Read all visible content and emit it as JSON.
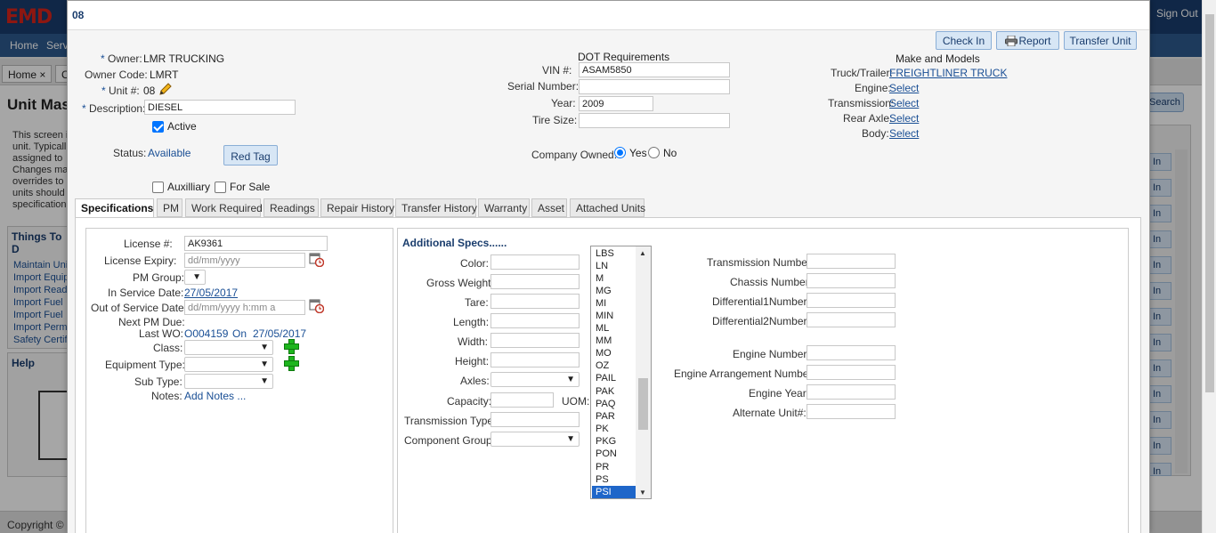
{
  "background": {
    "logo": "EMD",
    "sign_out": "Sign Out",
    "nav": [
      "Home",
      "Servi"
    ],
    "tabs": [
      "Home ×",
      "C"
    ],
    "page_title": "Unit Mas",
    "description": "This screen i unit. Typicall assigned to Changes ma overrides to units should specification",
    "things_to_do": {
      "title": "Things To D",
      "links": [
        "Maintain Uni",
        "Import Equip",
        "Import Read",
        "Import Fuel",
        "Import Fuel",
        "Import Perm",
        "Safety Certif"
      ]
    },
    "help_title": "Help",
    "search_label": "Search",
    "in_buttons": [
      "In",
      "In",
      "In",
      "In",
      "In",
      "In",
      "In",
      "In",
      "In",
      "In",
      "In",
      "In",
      "In"
    ],
    "footer": "Copyright © 2"
  },
  "modal": {
    "title": "08",
    "buttons": {
      "check_in": "Check In",
      "report": "Report",
      "transfer_unit": "Transfer Unit"
    },
    "owner": {
      "label": "Owner:",
      "value": "LMR TRUCKING"
    },
    "owner_code": {
      "label": "Owner Code:",
      "value": "LMRT"
    },
    "unit_number": {
      "label": "Unit #:",
      "value": "08"
    },
    "description": {
      "label": "Description:",
      "value": "DIESEL"
    },
    "active": {
      "label": "Active",
      "checked": true
    },
    "status": {
      "label": "Status:",
      "value": "Available"
    },
    "red_tag_button": "Red Tag",
    "auxiliary": {
      "label": "Auxilliary",
      "checked": false
    },
    "for_sale": {
      "label": "For Sale",
      "checked": false
    },
    "dot": {
      "title": "DOT Requirements",
      "vin": {
        "label": "VIN #:",
        "value": "ASAM5850"
      },
      "serial": {
        "label": "Serial Number:",
        "value": ""
      },
      "year": {
        "label": "Year:",
        "value": "2009"
      },
      "tire_size": {
        "label": "Tire Size:",
        "value": ""
      }
    },
    "company_owned": {
      "label": "Company Owned:",
      "yes": "Yes",
      "no": "No",
      "selected": "Yes"
    },
    "make_models": {
      "title": "Make and Models",
      "truck_trailer": {
        "label": "Truck/Trailer:",
        "value": "FREIGHTLINER TRUCK"
      },
      "engine": {
        "label": "Engine:",
        "value": "Select"
      },
      "transmission": {
        "label": "Transmission:",
        "value": "Select"
      },
      "rear_axle": {
        "label": "Rear Axle:",
        "value": "Select"
      },
      "body": {
        "label": "Body:",
        "value": "Select"
      }
    },
    "tabs": [
      "Specifications",
      "PM",
      "Work Required",
      "Readings",
      "Repair History",
      "Transfer History",
      "Warranty",
      "Asset",
      "Attached Units"
    ],
    "active_tab": "Specifications",
    "specs_left": {
      "license_number": {
        "label": "License #:",
        "value": "AK9361"
      },
      "license_expiry": {
        "label": "License Expiry:",
        "placeholder": "dd/mm/yyyy"
      },
      "pm_group": {
        "label": "PM Group:"
      },
      "in_service_date": {
        "label": "In Service Date:",
        "value": "27/05/2017"
      },
      "out_of_service_date": {
        "label": "Out of Service Date:",
        "placeholder": "dd/mm/yyyy h:mm a"
      },
      "next_pm_due": {
        "label": "Next PM Due:"
      },
      "last_wo": {
        "label": "Last WO:",
        "value": "O004159",
        "on_label": "On",
        "date": "27/05/2017"
      },
      "class": {
        "label": "Class:"
      },
      "equipment_type": {
        "label": "Equipment Type:"
      },
      "sub_type": {
        "label": "Sub Type:"
      },
      "notes": {
        "label": "Notes:",
        "link": "Add Notes ..."
      }
    },
    "specs_right": {
      "title": "Additional Specs......",
      "fields": [
        "Color:",
        "Gross Weight:",
        "Tare:",
        "Length:",
        "Width:",
        "Height:",
        "Axles:",
        "Capacity:",
        "Transmission Type:",
        "Component Group:"
      ],
      "uom_label": "UOM:",
      "uom_options": [
        "LBS",
        "LN",
        "M",
        "MG",
        "MI",
        "MIN",
        "ML",
        "MM",
        "MO",
        "OZ",
        "PAIL",
        "PAK",
        "PAQ",
        "PAR",
        "PK",
        "PKG",
        "PON",
        "PR",
        "PS",
        "PSI"
      ],
      "uom_selected": "PSI",
      "extra_fields": [
        "Transmission Number:",
        "Chassis Number:",
        "Differential1Number:",
        "Differential2Number:",
        "Engine Number:",
        "Engine Arrangement Number:",
        "Engine Year:",
        "Alternate Unit#:"
      ]
    }
  }
}
